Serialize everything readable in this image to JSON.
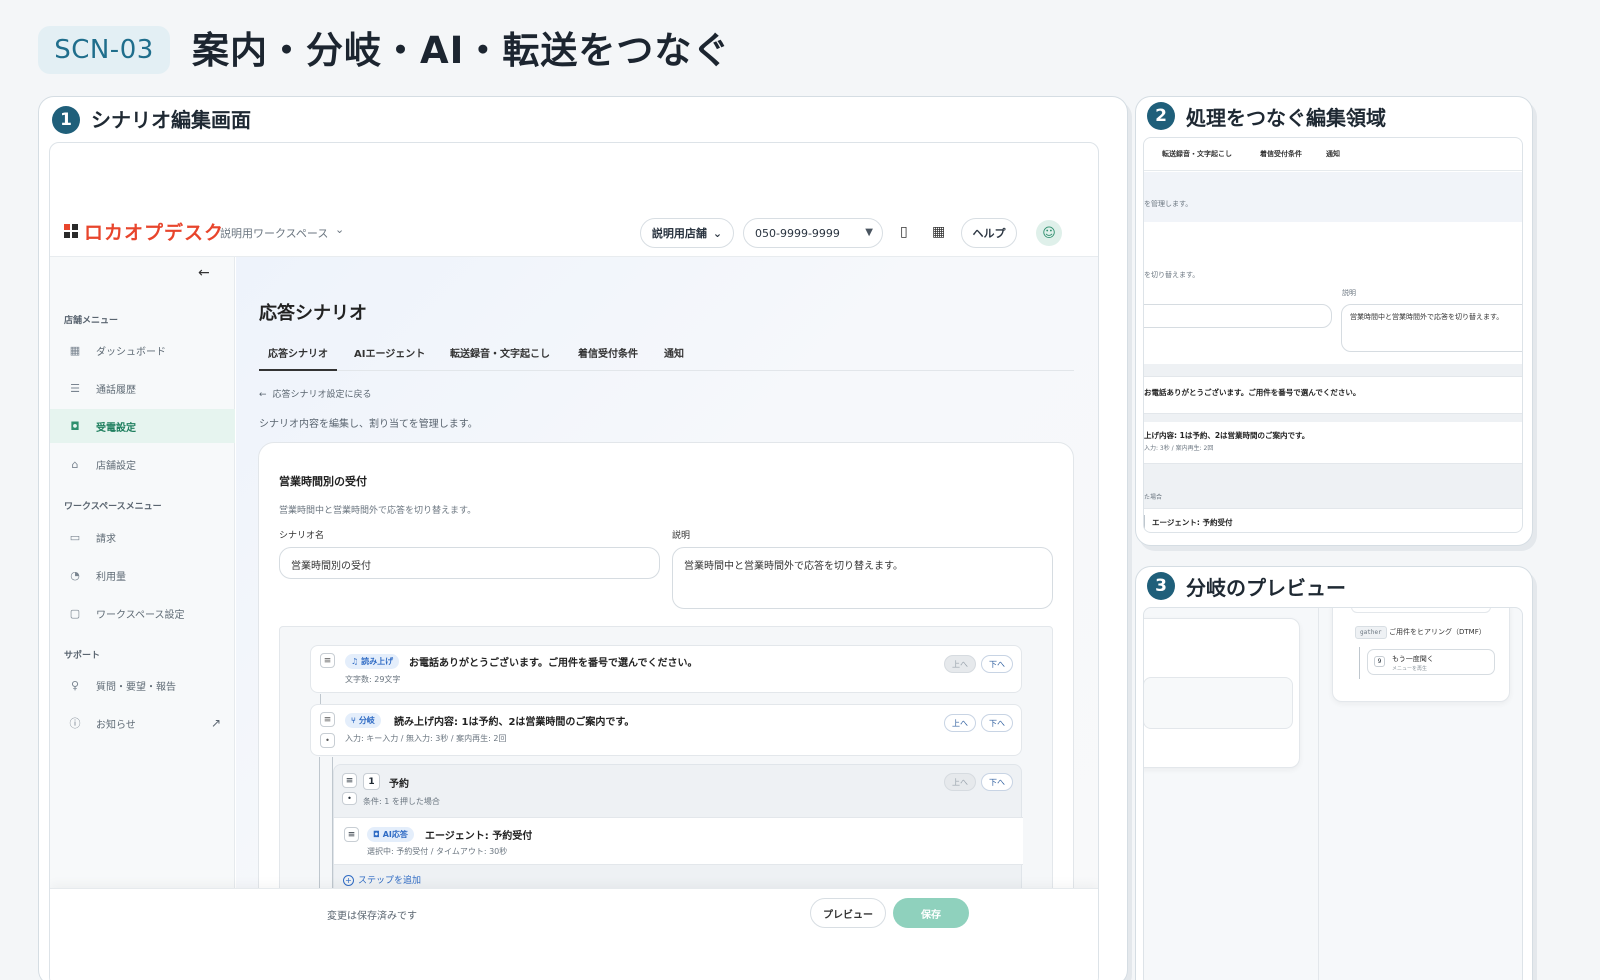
{
  "header": {
    "badge": "SCN-03",
    "title": "案内・分岐・AI・転送をつなぐ"
  },
  "panel1": {
    "num": "1",
    "title": "シナリオ編集画面",
    "app": {
      "logo": "ロカオプデスク",
      "workspace": "説明用ワークスペース",
      "store": "説明用店舗",
      "phone": "050-9999-9999",
      "help": "ヘルプ"
    },
    "sidebar": {
      "store_section": "店舗メニュー",
      "store_items": [
        {
          "label": "ダッシュボード",
          "icon": "grid-icon"
        },
        {
          "label": "通話履歴",
          "icon": "list-icon"
        },
        {
          "label": "受電設定",
          "icon": "robot-icon",
          "active": true
        },
        {
          "label": "店舗設定",
          "icon": "store-icon"
        }
      ],
      "ws_section": "ワークスペースメニュー",
      "ws_items": [
        {
          "label": "請求",
          "icon": "document-icon"
        },
        {
          "label": "利用量",
          "icon": "pie-icon"
        },
        {
          "label": "ワークスペース設定",
          "icon": "chat-icon"
        }
      ],
      "support_section": "サポート",
      "support_items": [
        {
          "label": "質問・要望・報告",
          "icon": "bulb-icon"
        },
        {
          "label": "お知らせ",
          "icon": "info-icon"
        }
      ]
    },
    "main": {
      "title": "応答シナリオ",
      "tabs": [
        "応答シナリオ",
        "AIエージェント",
        "転送録音・文字起こし",
        "着信受付条件",
        "通知"
      ],
      "back": "応答シナリオ設定に戻る",
      "desc": "シナリオ内容を編集し、割り当てを管理します。",
      "card": {
        "title": "営業時間別の受付",
        "subtitle": "営業時間中と営業時間外で応答を切り替えます。",
        "name_label": "シナリオ名",
        "name_value": "営業時間別の受付",
        "desc_label": "説明",
        "desc_value": "営業時間中と営業時間外で応答を切り替えます。"
      },
      "steps": [
        {
          "tag": "読み上げ",
          "text": "お電話ありがとうございます。ご用件を番号で選んでください。",
          "sub": "文字数: 29文字",
          "up": "上へ",
          "down": "下へ"
        },
        {
          "tag": "分岐",
          "text": "読み上げ内容: 1は予約、2は営業時間のご案内です。",
          "sub": "入力: キー入力 / 無入力: 3秒 / 案内再生: 2回",
          "up": "上へ",
          "down": "下へ"
        },
        {
          "num": "1",
          "text": "予約",
          "sub": "条件: 1 を押した場合",
          "up": "上へ",
          "down": "下へ"
        },
        {
          "tag": "AI応答",
          "text": "エージェント: 予約受付",
          "sub": "選択中: 予約受付 / タイムアウト: 30秒"
        }
      ],
      "add_step": "ステップを追加"
    },
    "footer": {
      "status": "変更は保存済みです",
      "preview": "プレビュー",
      "save": "保存"
    }
  },
  "panel2": {
    "num": "2",
    "title": "処理をつなぐ編集領域",
    "tabs": [
      "転送録音・文字起こし",
      "着信受付条件",
      "通知"
    ],
    "snippets": {
      "manage": "を管理します。",
      "switch": "を切り替えます。",
      "desc_label": "説明",
      "desc_value": "営業時間中と営業時間外で応答を切り替えます。",
      "greeting": "お電話ありがとうございます。ご用件を番号で選んでください。",
      "branch": "上げ内容: 1は予約、2は営業時間のご案内です。",
      "branch_sub": "入力: 3秒 / 案内再生: 2回",
      "cond": "た場合",
      "agent": "エージェント: 予約受付"
    }
  },
  "panel3": {
    "num": "3",
    "title": "分岐のプレビュー",
    "gather_code": "gather",
    "gather_text": "ご用件をヒアリング（DTMF）",
    "node_num": "9",
    "node_title": "もう一度聞く",
    "node_sub": "メニューを再生"
  }
}
